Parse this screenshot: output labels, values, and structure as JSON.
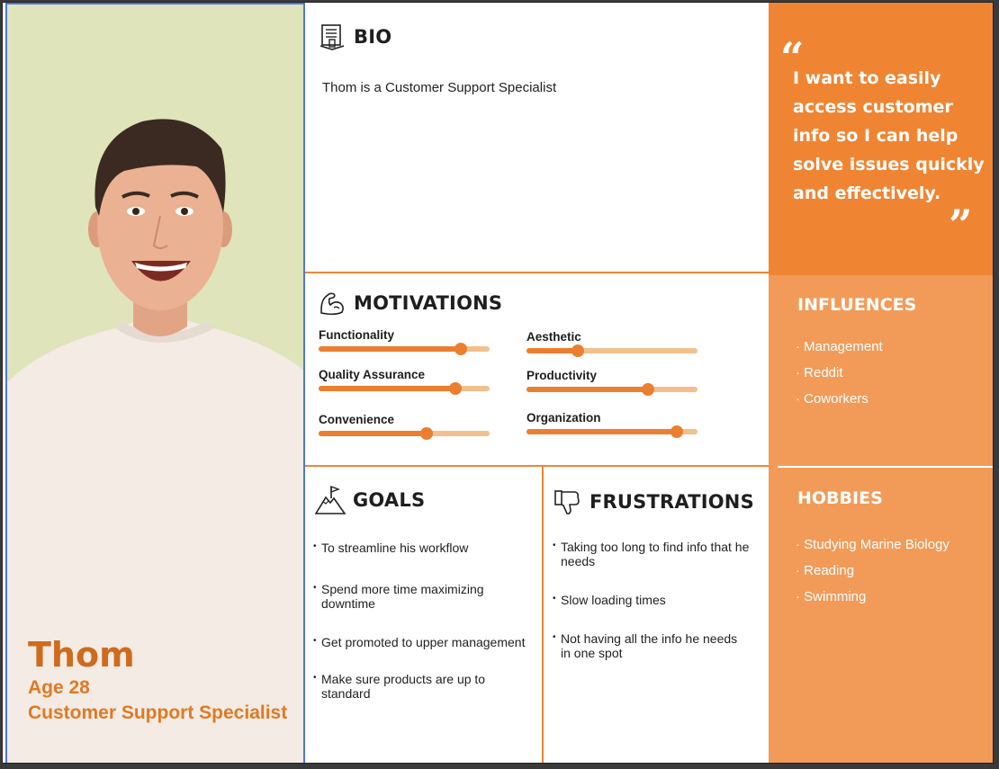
{
  "persona": {
    "name": "Thom",
    "age": "Age 28",
    "role": "Customer Support Specialist"
  },
  "bio": {
    "title": "BIO",
    "text": "Thom is a Customer Support Specialist"
  },
  "motivations": {
    "title": "MOTIVATIONS",
    "items": [
      {
        "label": "Functionality",
        "level": 0.83
      },
      {
        "label": "Aesthetic",
        "level": 0.3
      },
      {
        "label": "Quality Assurance",
        "level": 0.8
      },
      {
        "label": "Productivity",
        "level": 0.71
      },
      {
        "label": "Convenience",
        "level": 0.63
      },
      {
        "label": "Organization",
        "level": 0.88
      }
    ]
  },
  "goals": {
    "title": "GOALS",
    "items": [
      [
        "To streamline his workflow"
      ],
      [
        "Spend more time maximizing",
        "downtime"
      ],
      [
        "Get promoted to upper management"
      ],
      [
        "Make sure products are up to",
        "standard"
      ]
    ]
  },
  "frustrations": {
    "title": "FRUSTRATIONS",
    "items": [
      [
        "Taking too long to find info that he",
        "needs"
      ],
      [
        "Slow loading times"
      ],
      [
        "Not having all the info he needs",
        "in one spot"
      ]
    ]
  },
  "quote": {
    "open": "“",
    "close": "”",
    "text": "I want to easily access customer info so I can help solve issues quickly and effectively."
  },
  "influences": {
    "title": "INFLUENCES",
    "items": [
      "· Management",
      "· Reddit",
      "· Coworkers"
    ]
  },
  "hobbies": {
    "title": "HOBBIES",
    "items": [
      "· Studying Marine Biology",
      "· Reading",
      "· Swimming"
    ]
  },
  "icons": {
    "bio": "book-icon",
    "motivations": "flexed-arm-icon",
    "goals": "mountain-flag-icon",
    "frustrations": "thumbs-down-icon"
  },
  "colors": {
    "accent": "#ef8533",
    "accent_light": "#f29b58",
    "name": "#cf6b1e",
    "photo_bg": "#dfe4bb"
  }
}
